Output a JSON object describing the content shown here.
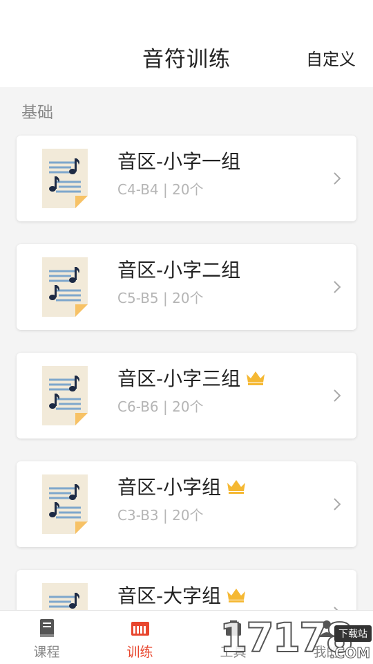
{
  "header": {
    "title": "音符训练",
    "action": "自定义"
  },
  "section": {
    "label": "基础"
  },
  "items": [
    {
      "title": "音区-小字一组",
      "subtitle": "C4-B4 | 20个",
      "premium": false
    },
    {
      "title": "音区-小字二组",
      "subtitle": "C5-B5 | 20个",
      "premium": false
    },
    {
      "title": "音区-小字三组",
      "subtitle": "C6-B6 | 20个",
      "premium": true
    },
    {
      "title": "音区-小字组",
      "subtitle": "C3-B3 | 20个",
      "premium": true
    },
    {
      "title": "音区-大字组",
      "subtitle": "",
      "premium": true
    }
  ],
  "tabs": [
    {
      "label": "课程",
      "icon": "book-icon"
    },
    {
      "label": "训练",
      "icon": "piano-icon",
      "active": true
    },
    {
      "label": "工具",
      "icon": "tools-icon"
    },
    {
      "label": "我的",
      "icon": "user-icon"
    }
  ],
  "watermark": {
    "digits": "17178",
    "badge": "下载站",
    "suffix": ".COM"
  },
  "colors": {
    "accent": "#e8462e",
    "crown": "#f5b833",
    "icon_paper": "#f2ead9",
    "icon_fold": "#f7c266",
    "icon_lines": "#7ea7cc",
    "icon_note": "#1d2a44"
  }
}
